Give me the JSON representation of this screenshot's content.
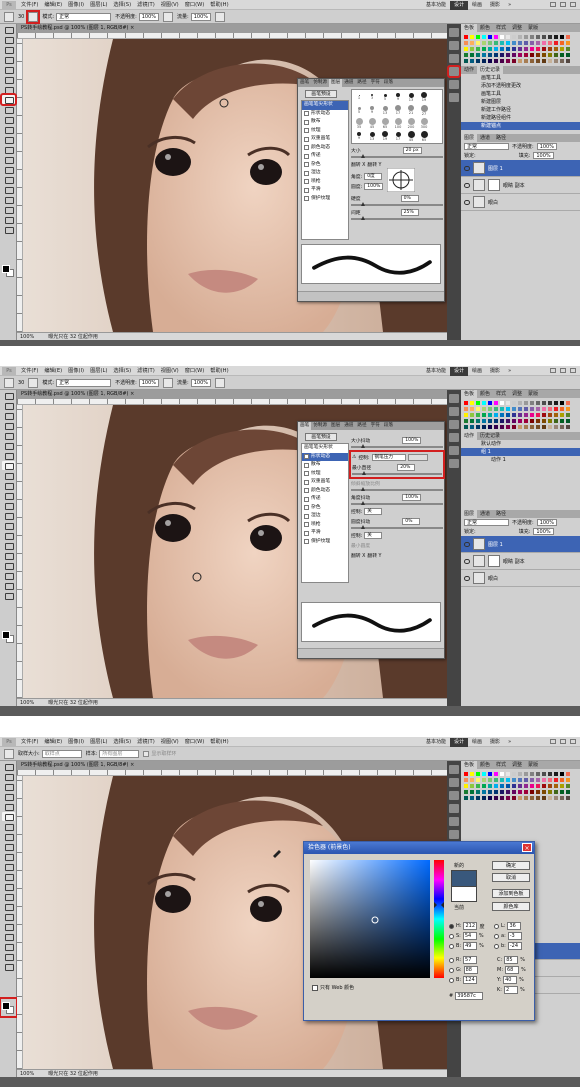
{
  "menus": [
    "文件(F)",
    "编辑(E)",
    "图像(I)",
    "图层(L)",
    "选择(S)",
    "滤镜(T)",
    "视图(V)",
    "窗口(W)",
    "帮助(H)"
  ],
  "logo": "Ps",
  "workspaces": [
    "基本功能",
    "设计",
    "绘画",
    "摄影"
  ],
  "workspaces_more": "»",
  "doc_tab": "PS转手绘教程.psd @ 100% (图层 1, RGB/8#)",
  "doc_tab_close": "×",
  "status": {
    "zoom": "100%",
    "info": "曝光只在 32 位起作用"
  },
  "brush_opts": {
    "mode_label": "模式:",
    "mode_value": "正常",
    "opacity_label": "不透明度:",
    "opacity_value": "100%",
    "flow_label": "流量:",
    "flow_value": "100%",
    "size_value": "30"
  },
  "eyedropper_opts": {
    "size_label": "取样大小:",
    "size_value": "取样点",
    "sample_label": "样本:",
    "sample_value": "所有图层",
    "ring_label": "显示取样环"
  },
  "color_panel_tabs": [
    "色板",
    "颜色",
    "样式",
    "调整",
    "蒙版"
  ],
  "history_tabs": [
    "动作",
    "历史记录"
  ],
  "history_items": [
    "画笔工具",
    "添加不透明度更改",
    "画笔工具",
    "新建图层",
    "新建工作路径",
    "新建路径组件",
    "新建锚点"
  ],
  "actions_items": [
    "默认动作",
    "组 1",
    "动作 1"
  ],
  "layers_tabs": [
    "图层",
    "通道",
    "路径"
  ],
  "layers_mode": "正常",
  "layers_opacity_label": "不透明度:",
  "layers_opacity": "100%",
  "layers_fill_label": "填充:",
  "layers_fill": "100%",
  "layers_lock_label": "锁定:",
  "layers": [
    "图层 1",
    "眼睛 副本",
    "眼白"
  ],
  "brush_panel": {
    "tabs": [
      "画笔",
      "仿制源",
      "图层",
      "通道",
      "路径",
      "字符",
      "段落"
    ],
    "preset_button": "画笔预设",
    "list": [
      "画笔笔尖形状",
      "形状动态",
      "散布",
      "纹理",
      "双重画笔",
      "颜色动态",
      "传递",
      "杂色",
      "湿边",
      "喷枪",
      "平滑",
      "保护纹理"
    ],
    "tip_sizes": [
      "1",
      "3",
      "5",
      "9",
      "13",
      "19",
      "5",
      "9",
      "13",
      "17",
      "21",
      "27",
      "35",
      "45",
      "65",
      "100",
      "200",
      "300",
      "9",
      "13",
      "19",
      "17",
      "45",
      "65"
    ],
    "size_label": "大小",
    "size_value": "20 px",
    "flip_x": "翻转 X",
    "flip_y": "翻转 Y",
    "angle_label": "角度:",
    "angle_value": "0度",
    "roundness_label": "圆度:",
    "roundness_value": "100%",
    "hardness_label": "硬度",
    "hardness_value": "0%",
    "spacing_label": "间距",
    "spacing_value": "25%",
    "size_jitter_label": "大小抖动",
    "size_jitter_value": "100%",
    "control_label": "控制:",
    "control_value": "钢笔压力",
    "min_diameter_label": "最小直径",
    "min_diameter_value": "20%",
    "tilt_scale_label": "倾斜缩放比例",
    "angle_jitter_label": "角度抖动",
    "angle_jitter_value": "100%",
    "control_off": "关",
    "roundness_jitter_label": "圆度抖动",
    "roundness_jitter_value": "0%",
    "min_roundness_label": "最小圆度"
  },
  "color_picker": {
    "title": "拾色器 (前景色)",
    "close": "×",
    "new_label": "新的",
    "current_label": "当前",
    "ok": "确定",
    "cancel": "取消",
    "add_swatch": "添加到色板",
    "libraries": "颜色库",
    "web_only": "只有 Web 颜色",
    "H": "212",
    "H_unit": "度",
    "S": "54",
    "S_unit": "%",
    "B": "49",
    "B_unit": "%",
    "R": "57",
    "G": "88",
    "Bl": "124",
    "L": "36",
    "a": "-3",
    "b": "-24",
    "C": "85",
    "M": "68",
    "Y": "40",
    "K": "2",
    "pct": "%",
    "hex": "39587c",
    "new_color": "#39587c",
    "current_color": "#ffffff"
  },
  "accent_color": "#3d64b4",
  "highlight_color": "#d21f1f"
}
